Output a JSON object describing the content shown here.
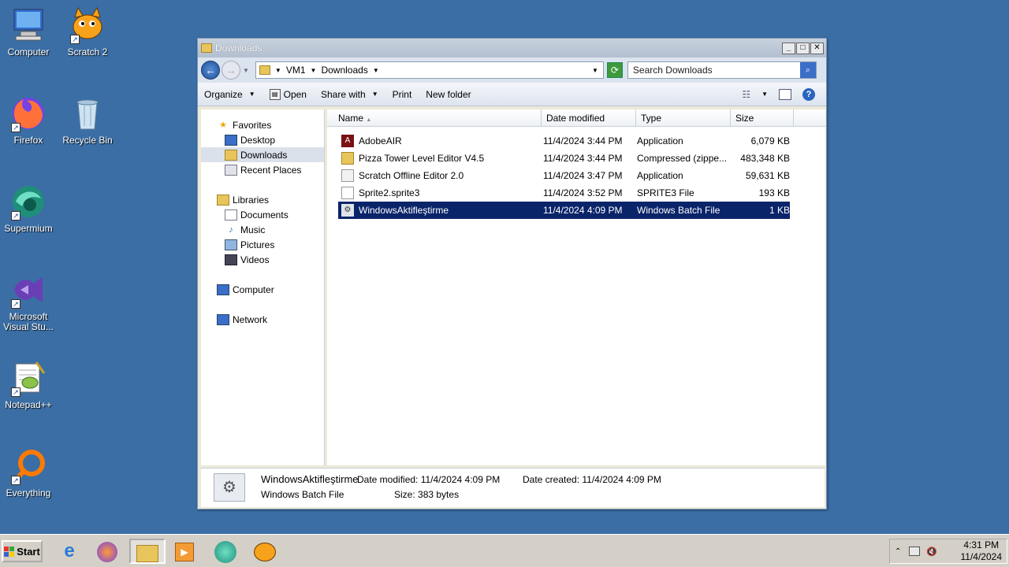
{
  "desktop": {
    "icons": [
      {
        "label": "Computer"
      },
      {
        "label": "Scratch 2"
      },
      {
        "label": "Firefox"
      },
      {
        "label": "Recycle Bin"
      },
      {
        "label": "Supermium"
      },
      {
        "label": "Microsoft Visual Stu..."
      },
      {
        "label": "Notepad++"
      },
      {
        "label": "Everything"
      }
    ]
  },
  "window": {
    "title": "Downloads",
    "address": {
      "segments": [
        "VM1",
        "Downloads"
      ]
    },
    "search_placeholder": "Search Downloads",
    "toolbar": {
      "organize": "Organize",
      "open": "Open",
      "share_with": "Share with",
      "print": "Print",
      "new_folder": "New folder"
    },
    "nav": {
      "favorites": "Favorites",
      "desktop": "Desktop",
      "downloads": "Downloads",
      "recent_places": "Recent Places",
      "libraries": "Libraries",
      "documents": "Documents",
      "music": "Music",
      "pictures": "Pictures",
      "videos": "Videos",
      "computer": "Computer",
      "network": "Network"
    },
    "columns": {
      "name": "Name",
      "date": "Date modified",
      "type": "Type",
      "size": "Size"
    },
    "files": [
      {
        "name": "AdobeAIR",
        "date": "11/4/2024 3:44 PM",
        "type": "Application",
        "size": "6,079 KB"
      },
      {
        "name": "Pizza Tower Level Editor V4.5",
        "date": "11/4/2024 3:44 PM",
        "type": "Compressed (zippe...",
        "size": "483,348 KB"
      },
      {
        "name": "Scratch Offline Editor 2.0",
        "date": "11/4/2024 3:47 PM",
        "type": "Application",
        "size": "59,631 KB"
      },
      {
        "name": "Sprite2.sprite3",
        "date": "11/4/2024 3:52 PM",
        "type": "SPRITE3 File",
        "size": "193 KB"
      },
      {
        "name": "WindowsAktifleştirme",
        "date": "11/4/2024 4:09 PM",
        "type": "Windows Batch File",
        "size": "1 KB"
      }
    ],
    "details": {
      "name": "WindowsAktifleştirme",
      "type": "Windows Batch File",
      "date_modified_label": "Date modified:",
      "date_modified": "11/4/2024 4:09 PM",
      "date_created_label": "Date created:",
      "date_created": "11/4/2024 4:09 PM",
      "size_label": "Size:",
      "size": "383 bytes"
    }
  },
  "taskbar": {
    "start": "Start",
    "clock_time": "4:31 PM",
    "clock_date": "11/4/2024"
  }
}
